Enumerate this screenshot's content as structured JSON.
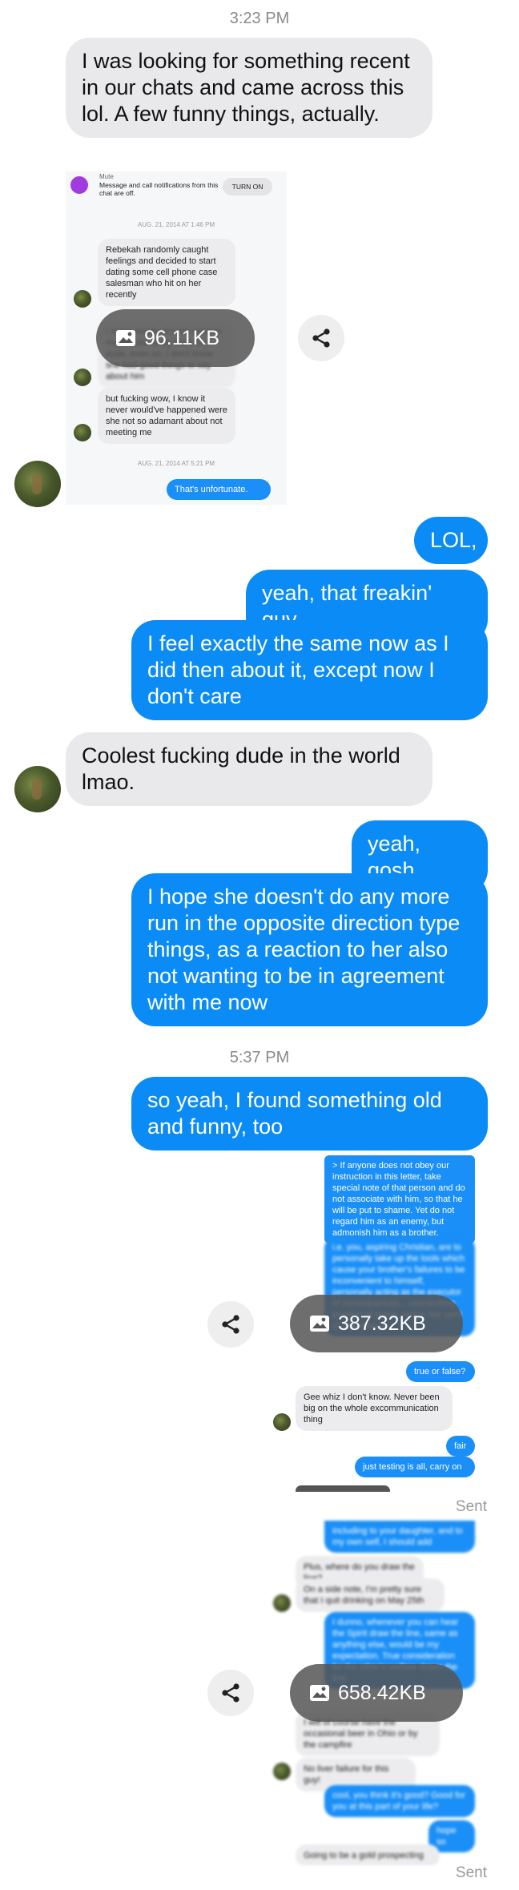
{
  "timestamps": {
    "first": "3:23 PM",
    "second": "5:37 PM"
  },
  "messages": {
    "m1": "I was looking for something recent in our chats and came across this lol. A few funny things, actually.",
    "m2": "LOL,",
    "m3": "yeah, that freakin' guy",
    "m4": "I feel exactly the same now as I did then about it, except now I don't care",
    "m5": "Coolest fucking dude in the world lmao.",
    "m6": "yeah, gosh",
    "m7": "I hope she doesn't do any more run in the opposite direction type things, as a reaction to her also not wanting to be in agreement with me now",
    "m8": "so yeah, I found something old and funny, too"
  },
  "attachments": [
    {
      "size": "96.11KB"
    },
    {
      "size": "387.32KB"
    },
    {
      "size": "658.42KB"
    }
  ],
  "status": {
    "sent1": "Sent",
    "sent2": "Sent"
  },
  "shot1": {
    "mute_title": "Mute",
    "mute_text": "Message and call notifications from this chat are off.",
    "turn_on": "TURN ON",
    "date1": "AUG. 21, 2014 AT 1:46 PM",
    "b1": "Rebekah randomly caught feelings and decided to start dating some cell phone case salesman who hit on her recently",
    "b2": "I mean maybe it's not random maybe she really likes the dude, even so, I don't know she had good things to say about him",
    "b3": "but fucking wow, I know it never would've happened were she not so adamant about not meeting me",
    "date2": "AUG. 21, 2014 AT 5:21 PM",
    "b4": "That's unfortunate."
  },
  "shot2": {
    "r1": "> If anyone does not obey our instruction in this letter, take special note of that person and do not associate with him, so that he will be put to shame. Yet do not regard him as an enemy, but admonish him as a brother.",
    "r2": "i.e. you, aspiring Christian, are to personally take up the tools which cause your brother's failures to be inconvenient to himself, personally acting as the executor of consequences... overarching position of grace, and in the spirit of repentance",
    "r3": "true or false?",
    "l1": "Gee whiz I don't know. Never been big on the whole excommunication thing",
    "r4": "fair",
    "r5": "just testing is all, carry on"
  },
  "shot3": {
    "r1": "including to your daughter, and to my own self, I should add",
    "l1": "Plus, where do you draw the line?",
    "l2": "On a side note, I'm pretty sure that I quit drinking on May 25th",
    "r2": "I dunno, whenever you can hear the Spirit draw the line, same as anything else, would be my expectation. True consideration for the other's welfare draws the line",
    "l3": "I will of course have the occasional beer in Ohio or by the campfire",
    "l4": "No liver failure for this guy!",
    "r3": "cool, you think it's good? Good for you at this part of your life?",
    "r4": "hope so",
    "l5": "Going to be a gold prospecting"
  }
}
